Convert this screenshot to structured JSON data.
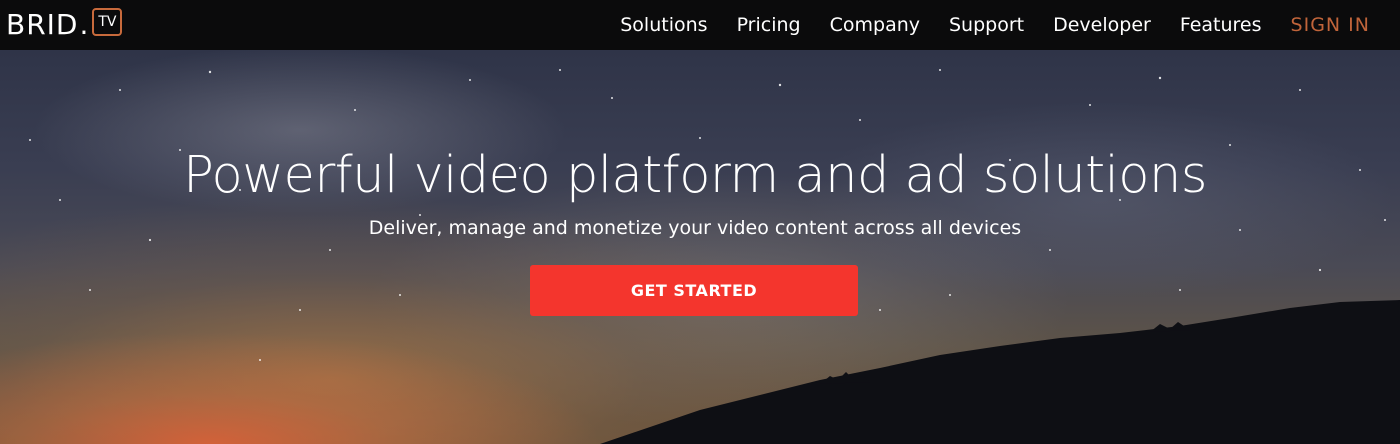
{
  "header": {
    "logo": {
      "word": "BRID",
      "dot": ".",
      "badge": "TV"
    },
    "nav": [
      {
        "label": "Solutions"
      },
      {
        "label": "Pricing"
      },
      {
        "label": "Company"
      },
      {
        "label": "Support"
      },
      {
        "label": "Developer"
      },
      {
        "label": "Features"
      },
      {
        "label": "SIGN IN"
      }
    ]
  },
  "hero": {
    "title": "Powerful video platform and ad solutions",
    "subtitle": "Deliver, manage and monetize your video content across all devices",
    "cta_label": "GET STARTED"
  },
  "colors": {
    "navbar_bg": "#0b0b0c",
    "accent_signin": "#c0643a",
    "logo_badge_border": "#c86a3c",
    "cta_bg": "#f4352d"
  }
}
